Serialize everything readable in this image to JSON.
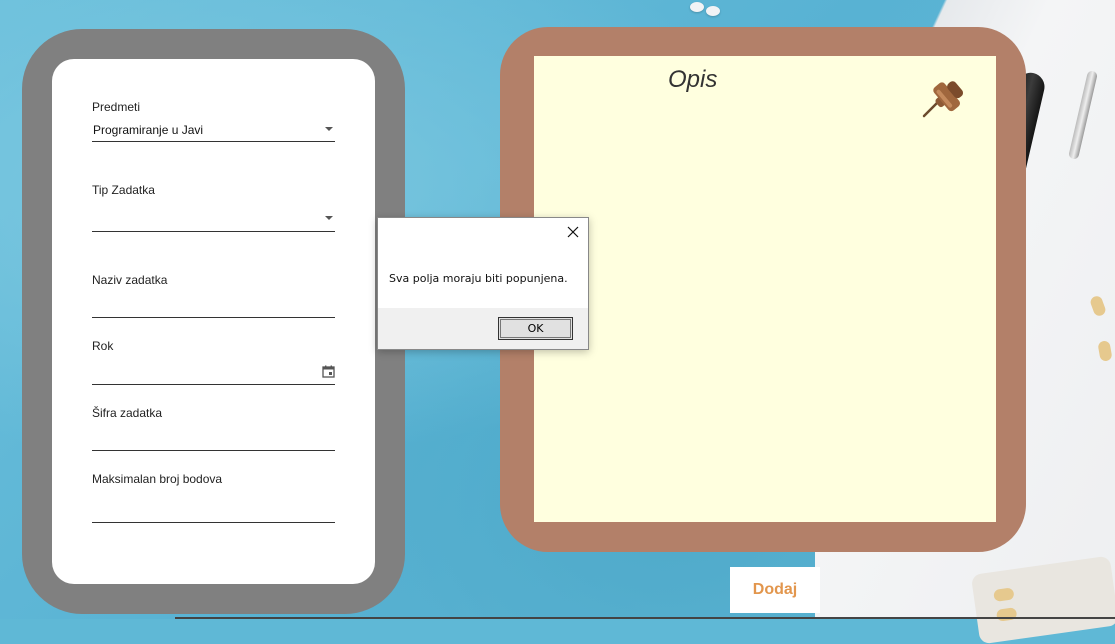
{
  "form": {
    "predmeti": {
      "label": "Predmeti",
      "value": "Programiranje u Javi"
    },
    "tip_zadatka": {
      "label": "Tip Zadatka",
      "value": ""
    },
    "naziv_zadatka": {
      "label": "Naziv zadatka",
      "value": ""
    },
    "rok": {
      "label": "Rok",
      "value": "",
      "icon": "calendar-icon"
    },
    "sifra_zadatka": {
      "label": "Šifra zadatka",
      "value": ""
    },
    "maks_bodova": {
      "label": "Maksimalan broj bodova",
      "value": ""
    }
  },
  "note": {
    "title": "Opis",
    "icon": "pushpin-icon"
  },
  "dialog": {
    "message": "Sva polja moraju biti popunjena.",
    "ok_label": "OK",
    "close_icon": "close-icon"
  },
  "actions": {
    "dodaj_label": "Dodaj"
  },
  "colors": {
    "form_frame": "#808080",
    "note_frame": "#b38069",
    "note_paper": "#ffffdf",
    "dodaj_text": "#e2964d"
  }
}
